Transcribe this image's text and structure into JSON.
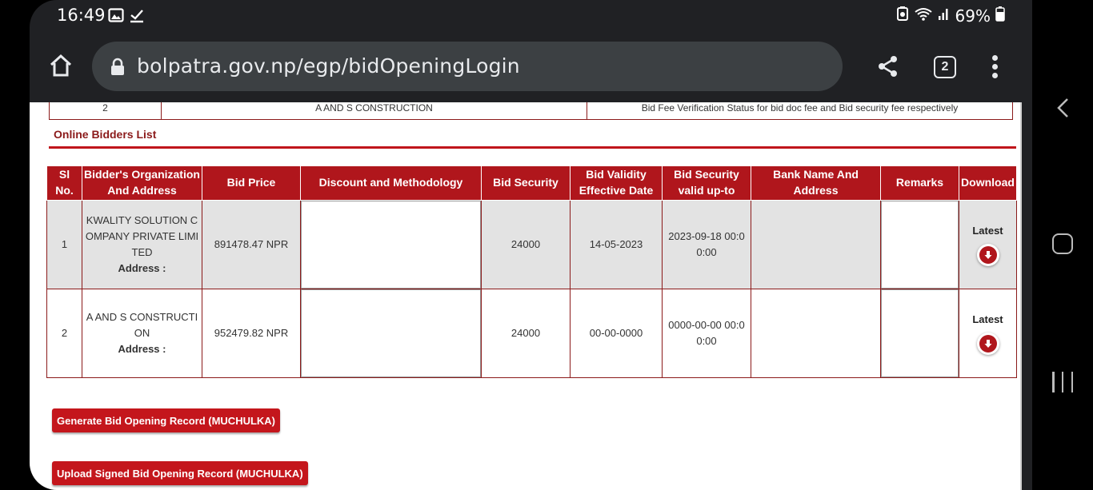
{
  "status_bar": {
    "time": "16:49",
    "battery": "69%",
    "icons": [
      "image-icon",
      "download-done-icon",
      "battery-saver-icon",
      "wifi-icon",
      "signal-icon",
      "battery-icon"
    ]
  },
  "browser": {
    "url": "bolpatra.gov.np/egp/bidOpeningLogin",
    "tab_count": "2"
  },
  "top_row": {
    "num": "2",
    "name": "A AND S CONSTRUCTION",
    "note": "Bid Fee Verification Status for bid doc fee and Bid security fee respectively"
  },
  "section_title": "Online Bidders List",
  "table": {
    "headers": [
      "Sl No.",
      "Bidder's Organization And Address",
      "Bid Price",
      "Discount and Methodology",
      "Bid Security",
      "Bid Validity Effective Date",
      "Bid Security valid up-to",
      "Bank Name And Address",
      "Remarks",
      "Download"
    ],
    "rows": [
      {
        "sl": "1",
        "org": "KWALITY SOLUTION COMPANY PRIVATE LIMITED",
        "address_label": "Address :",
        "bid_price": "891478.47 NPR",
        "bid_security": "24000",
        "validity_date": "14-05-2023",
        "security_valid_upto": "2023-09-18 00:00:00",
        "bank": "",
        "download_label": "Latest"
      },
      {
        "sl": "2",
        "org": "A AND S CONSTRUCTION",
        "address_label": "Address :",
        "bid_price": "952479.82 NPR",
        "bid_security": "24000",
        "validity_date": "00-00-0000",
        "security_valid_upto": "0000-00-00 00:00:00",
        "bank": "",
        "download_label": "Latest"
      }
    ]
  },
  "buttons": {
    "generate": "Generate Bid Opening Record (MUCHULKA)",
    "upload": "Upload Signed Bid Opening Record (MUCHULKA)"
  },
  "colors": {
    "accent": "#c4161c",
    "header_bg": "#b0161c",
    "title": "#8b1a1a"
  }
}
